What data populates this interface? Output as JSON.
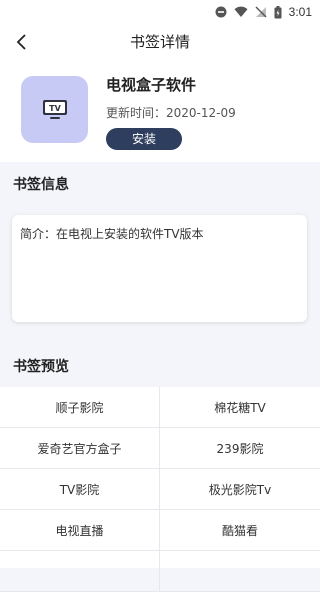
{
  "status_bar": {
    "time": "3:01"
  },
  "header": {
    "title": "书签详情"
  },
  "app": {
    "name": "电视盒子软件",
    "update_label": "更新时间：",
    "update_date": "2020-12-09",
    "install_label": "安装",
    "icon": "tv-icon"
  },
  "info_section": {
    "title": "书签信息",
    "intro": "简介：在电视上安装的软件TV版本"
  },
  "preview_section": {
    "title": "书签预览",
    "items": [
      "顺子影院",
      "棉花糖TV",
      "爱奇艺官方盒子",
      "239影院",
      "TV影院",
      "极光影院Tv",
      "电视直播",
      "酷猫看",
      "",
      ""
    ]
  },
  "colors": {
    "accent": "#2e3e5e",
    "icon_bg": "#c8caf6",
    "page_bg": "#f3f5fa"
  }
}
